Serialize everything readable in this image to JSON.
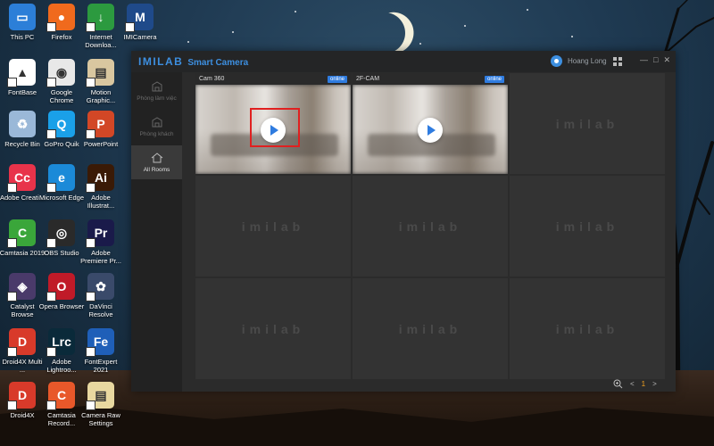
{
  "desktop": {
    "icons": [
      {
        "label": "This PC",
        "color": "#2c7fd8",
        "glyph": "▭"
      },
      {
        "label": "Firefox",
        "color": "#f06a1d",
        "glyph": "●"
      },
      {
        "label": "Internet Downloa...",
        "color": "#2c9a3f",
        "glyph": "↓"
      },
      {
        "label": "IMICamera",
        "color": "#1f4a8a",
        "glyph": "M"
      },
      {
        "label": "FontBase",
        "color": "#ffffff",
        "glyph": "▲"
      },
      {
        "label": "Google Chrome",
        "color": "#e8e8e8",
        "glyph": "◉"
      },
      {
        "label": "Motion Graphic...",
        "color": "#d9c7a0",
        "glyph": "▤"
      },
      {
        "label": "Recycle Bin",
        "color": "#9ab8d8",
        "glyph": "♻"
      },
      {
        "label": "GoPro Quik",
        "color": "#1aa0e8",
        "glyph": "Q"
      },
      {
        "label": "PowerPoint",
        "color": "#d24726",
        "glyph": "P"
      },
      {
        "label": "Adobe Creati...",
        "color": "#e8334a",
        "glyph": "Cc"
      },
      {
        "label": "Microsoft Edge",
        "color": "#1b8ad8",
        "glyph": "e"
      },
      {
        "label": "Adobe Illustrat...",
        "color": "#3a1a06",
        "glyph": "Ai"
      },
      {
        "label": "Camtasia 2019",
        "color": "#3aa63a",
        "glyph": "C"
      },
      {
        "label": "OBS Studio",
        "color": "#2a2a2a",
        "glyph": "◎"
      },
      {
        "label": "Adobe Premiere Pr...",
        "color": "#1a1a4a",
        "glyph": "Pr"
      },
      {
        "label": "Catalyst Browse",
        "color": "#4a3a6a",
        "glyph": "◈"
      },
      {
        "label": "Opera Browser",
        "color": "#c01a28",
        "glyph": "O"
      },
      {
        "label": "DaVinci Resolve",
        "color": "#3a4a6a",
        "glyph": "✿"
      },
      {
        "label": "Droid4X Multi ...",
        "color": "#d83a2a",
        "glyph": "D"
      },
      {
        "label": "Adobe Lightroo...",
        "color": "#0a2a3a",
        "glyph": "Lrc"
      },
      {
        "label": "FontExpert 2021",
        "color": "#1f5fb8",
        "glyph": "Fe"
      },
      {
        "label": "Droid4X",
        "color": "#d83a2a",
        "glyph": "D"
      },
      {
        "label": "Camtasia Record...",
        "color": "#e8582a",
        "glyph": "C"
      },
      {
        "label": "Camera Raw Settings",
        "color": "#e8d8a0",
        "glyph": "▤"
      }
    ]
  },
  "window": {
    "brand": "IMILAB",
    "title": "Smart Camera",
    "user_name": "Hoang Long",
    "controls": [
      "—",
      "□",
      "✕"
    ]
  },
  "sidebar": {
    "rooms": [
      {
        "label": "Phòng làm việc",
        "active": false
      },
      {
        "label": "Phòng khách",
        "active": false
      },
      {
        "label": "All Rooms",
        "active": true
      }
    ]
  },
  "cameras": [
    {
      "name": "Cam 360",
      "status": "online"
    },
    {
      "name": "2F-CAM",
      "status": "online"
    }
  ],
  "empty_tile_watermark": "imilab",
  "footer": {
    "zoom_icon": "zoom-in-icon",
    "prev": "<",
    "page": "1",
    "next": ">"
  },
  "colors": {
    "accent": "#2f7ce0",
    "highlight": "#e02020",
    "page_active": "#f0a020"
  }
}
